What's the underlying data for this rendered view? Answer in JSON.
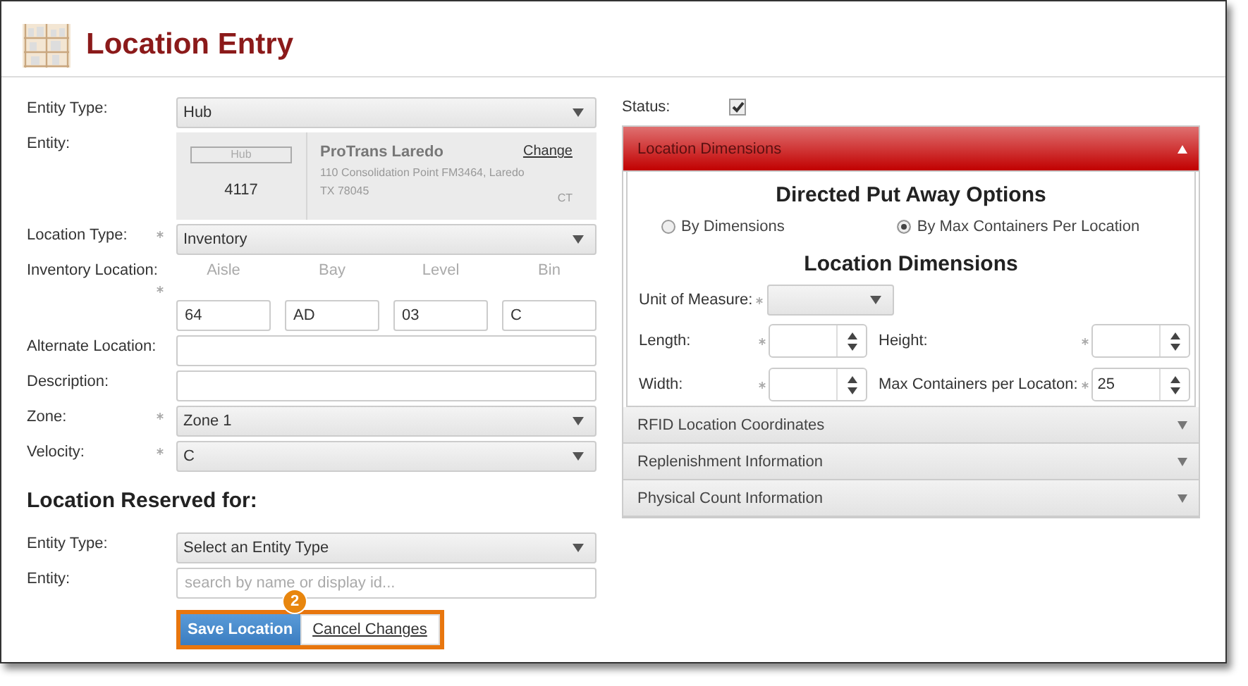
{
  "header": {
    "title": "Location Entry"
  },
  "form": {
    "fields": [
      {
        "kind": "select",
        "label": "Entity Type:",
        "required": false,
        "value": "Hub"
      },
      {
        "kind": "entity",
        "label": "Entity:",
        "required": false,
        "tag": "Hub",
        "id": "4117",
        "name": "ProTrans Laredo",
        "link": "Change",
        "address": "110 Consolidation Point FM3464, Laredo",
        "city": "TX 78045",
        "code": "CT"
      },
      {
        "kind": "select",
        "label": "Location Type:",
        "required": true,
        "value": "Inventory"
      },
      {
        "kind": "inventory",
        "label": "Inventory Location:",
        "required": true,
        "parts": [
          {
            "header": "Aisle",
            "value": "64"
          },
          {
            "header": "Bay",
            "value": "AD"
          },
          {
            "header": "Level",
            "value": "03"
          },
          {
            "header": "Bin",
            "value": "C"
          }
        ]
      },
      {
        "kind": "text",
        "label": "Alternate Location:",
        "required": false
      },
      {
        "kind": "text",
        "label": "Description:",
        "required": false
      },
      {
        "kind": "select",
        "label": "Zone:",
        "required": true,
        "value": "Zone 1"
      },
      {
        "kind": "select",
        "label": "Velocity:",
        "required": true,
        "value": "C"
      }
    ]
  },
  "reserved": {
    "heading": "Location Reserved for:",
    "fields": [
      {
        "kind": "select",
        "label": "Entity Type:",
        "required": false,
        "value": "Select an Entity Type"
      },
      {
        "kind": "text",
        "label": "Entity:",
        "required": false,
        "placeholder": "search by name or display id..."
      }
    ]
  },
  "buttons": [
    {
      "kind": "primary",
      "label": "Save Location"
    },
    {
      "kind": "link",
      "label": "Cancel Changes"
    }
  ],
  "callout": {
    "number": "2"
  },
  "status": {
    "label": "Status:",
    "checked": true
  },
  "panels": [
    {
      "title": "Location Dimensions",
      "expanded": true,
      "options_heading": "Directed Put Away Options",
      "radios": [
        {
          "label": "By Dimensions",
          "selected": false
        },
        {
          "label": "By Max Containers Per Location",
          "selected": true
        }
      ],
      "dims_heading": "Location Dimensions",
      "unit": {
        "label": "Unit of Measure:",
        "required": true
      },
      "spinners": [
        {
          "label": "Length:",
          "required": true
        },
        {
          "label": "Height:",
          "required": true
        },
        {
          "label": "Width:",
          "required": true
        },
        {
          "label": "Max Containers per Locaton:",
          "required": true,
          "value": "25"
        }
      ]
    },
    {
      "title": "RFID Location Coordinates",
      "expanded": false
    },
    {
      "title": "Replenishment Information",
      "expanded": false
    },
    {
      "title": "Physical Count Information",
      "expanded": false
    }
  ]
}
